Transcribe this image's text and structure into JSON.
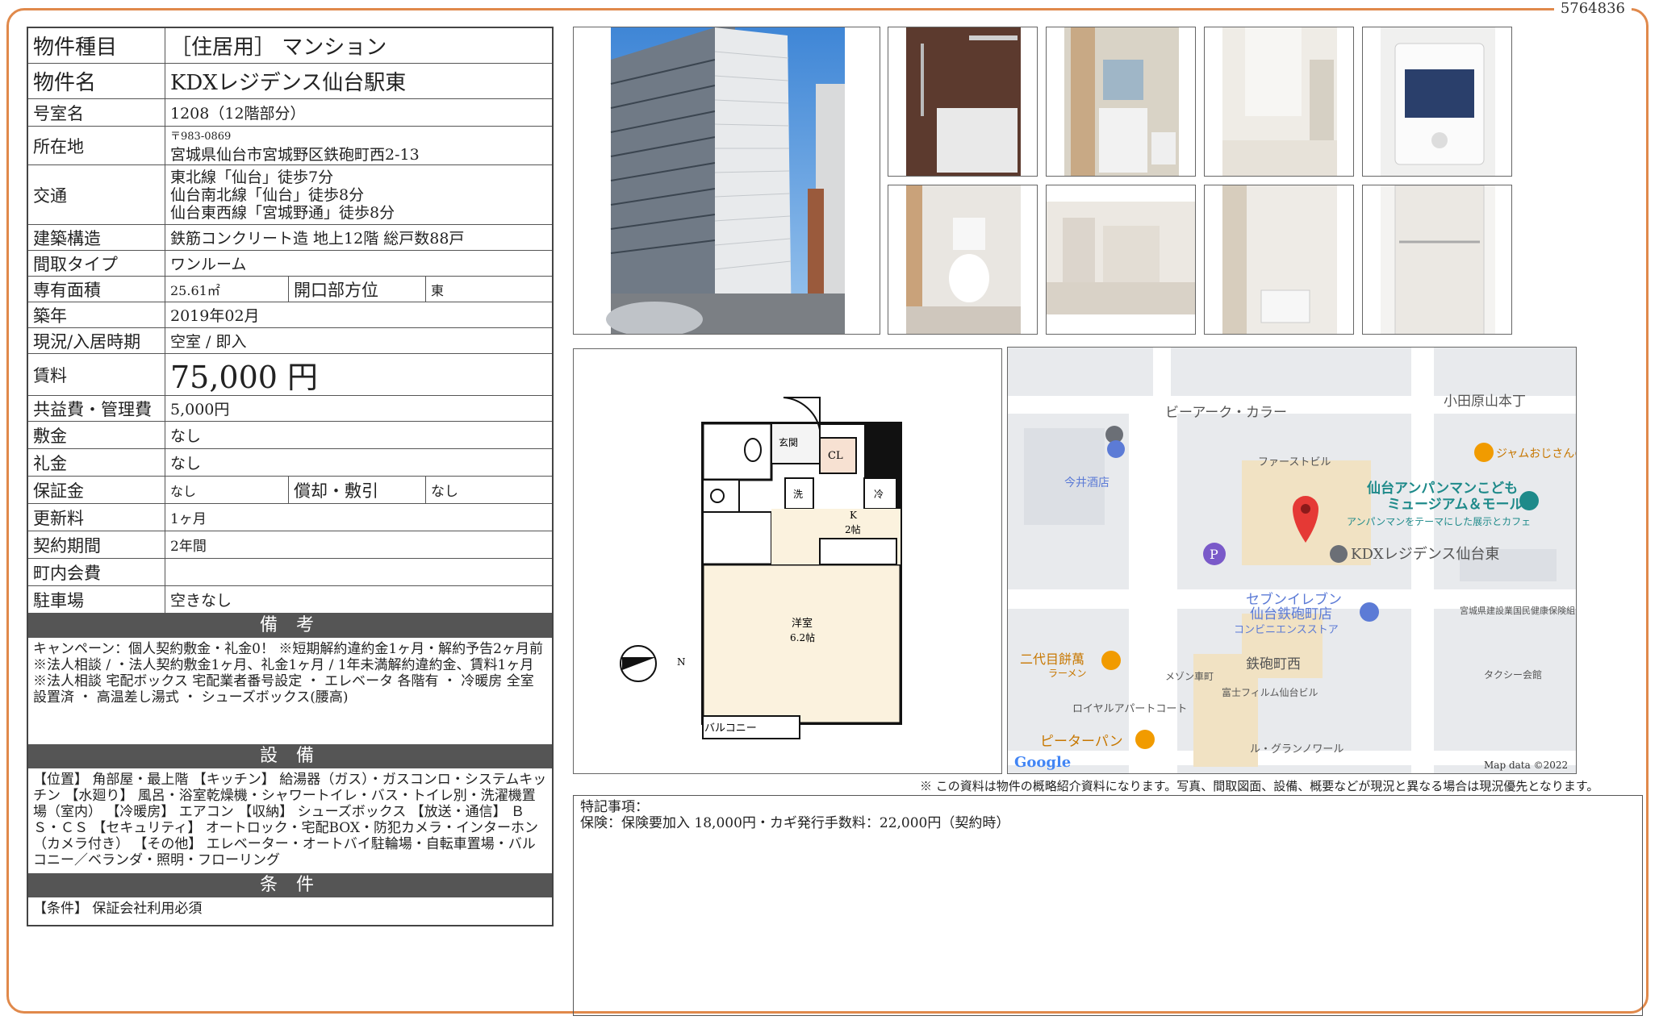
{
  "doc_id": "5764836",
  "property": {
    "rows": [
      {
        "label": "物件種目",
        "value": "［住居用］ マンション"
      },
      {
        "label": "物件名",
        "value": "KDXレジデンス仙台駅東"
      },
      {
        "label": "号室名",
        "value": "1208（12階部分）"
      },
      {
        "label": "所在地",
        "postal": "〒983-0869",
        "value": "宮城県仙台市宮城野区鉄砲町西2-13"
      },
      {
        "label": "交通",
        "lines": [
          "東北線「仙台」徒歩7分",
          "仙台南北線「仙台」徒歩8分",
          "仙台東西線「宮城野通」徒歩8分"
        ]
      },
      {
        "label": "建築構造",
        "value": "鉄筋コンクリート造 地上12階 総戸数88戸"
      },
      {
        "label": "間取タイプ",
        "value": "ワンルーム"
      },
      {
        "label": "専有面積",
        "value": "25.61㎡",
        "sub_label": "開口部方位",
        "sub_value": "東"
      },
      {
        "label": "築年",
        "value": "2019年02月"
      },
      {
        "label": "現況/入居時期",
        "value": "空室 / 即入"
      },
      {
        "label": "賃料",
        "value": "75,000 円"
      },
      {
        "label": "共益費・管理費",
        "value": "5,000円"
      },
      {
        "label": "敷金",
        "value": "なし"
      },
      {
        "label": "礼金",
        "value": "なし"
      },
      {
        "label": "保証金",
        "value": "なし",
        "sub_label": "償却・敷引",
        "sub_value": "なし"
      },
      {
        "label": "更新料",
        "value": "1ヶ月"
      },
      {
        "label": "契約期間",
        "value": "2年間"
      },
      {
        "label": "町内会費",
        "value": ""
      },
      {
        "label": "駐車場",
        "value": "空きなし"
      }
    ]
  },
  "remarks": {
    "title": "備 考",
    "text": "キャンペーン：個人契約敷金・礼金0！ ※短期解約違約金1ヶ月・解約予告2ヶ月前※法人相談 / ・法人契約敷金1ヶ月、礼金1ヶ月 / 1年未満解約違約金、賃料1ヶ月※法人相談 宅配ボックス 宅配業者番号設定 ・ エレベータ 各階有 ・ 冷暖房 全室設置済 ・ 高温差し湯式 ・ シューズボックス(腰高)"
  },
  "facilities": {
    "title": "設 備",
    "text": "【位置】 角部屋・最上階 【キッチン】 給湯器（ガス）・ガスコンロ・システムキッチン 【水廻り】 風呂・浴室乾燥機・シャワートイレ・バス・トイレ別・洗濯機置場（室内） 【冷暖房】 エアコン 【収納】 シューズボックス 【放送・通信】 ＢＳ・ＣＳ 【セキュリティ】 オートロック・宅配BOX・防犯カメラ・インターホン（カメラ付き） 【その他】 エレベーター・オートバイ駐輪場・自転車置場・バルコニー／ベランダ・照明・フローリング"
  },
  "conditions": {
    "title": "条 件",
    "text": "【条件】 保証会社利用必須"
  },
  "floorplan": {
    "labels": [
      "玄関",
      "CL",
      "洗",
      "冷",
      "K",
      "2帖",
      "洋室",
      "6.2帖",
      "バルコニー",
      "N"
    ]
  },
  "map": {
    "labels": [
      "ビーアーク・カラー",
      "小田原山本丁",
      "ファーストビル",
      "今井酒店",
      "仙台アンパンマンこども",
      "ミュージアム＆モール",
      "アンパンマンをテーマにした展示とカフェ",
      "KDXレジデンス仙台東",
      "セブンイレブン",
      "仙台鉄砲町店",
      "コンビニエンスストア",
      "宮城県建設業国民健康保険組合",
      "二代目餅萬",
      "ラーメン",
      "メゾン車町",
      "鉄砲町西",
      "タクシー会館",
      "富士フィルム仙台ビル",
      "ロイヤルアパートコート",
      "ピーターパン",
      "ル・グランノワール",
      "ジャムおじさんのパン工場",
      "Google",
      "Map data ©2022"
    ]
  },
  "disclaimer": "※ この資料は物件の概略紹介資料になります。写真、間取図面、設備、概要などが現況と異なる場合は現況優先となります。",
  "special": {
    "title": "特記事項：",
    "text": "保険：保険要加入 18,000円・カギ発行手数料：22,000円（契約時）"
  },
  "colors": {
    "frame": "#e0894b",
    "bar": "#555555",
    "map_pin": "#e53935",
    "map_label_teal": "#1e8a8a"
  }
}
